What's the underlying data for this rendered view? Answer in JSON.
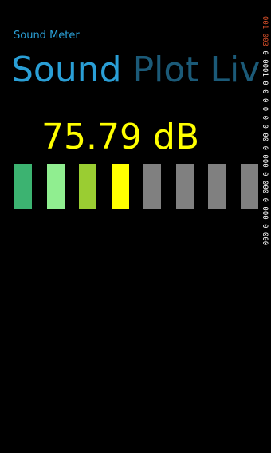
{
  "app": {
    "title": "Sound Meter"
  },
  "pivot": {
    "tabs": [
      {
        "label": "Sound",
        "active": true
      },
      {
        "label": "Plot",
        "active": false
      },
      {
        "label": "Live",
        "active": false
      }
    ]
  },
  "meter": {
    "reading": "75.79 dB",
    "reading_color": "#ffff00",
    "level_fraction": 0.5,
    "bars": [
      {
        "color": "#3cb371",
        "lit": true
      },
      {
        "color": "#90ee90",
        "lit": true
      },
      {
        "color": "#9acd32",
        "lit": true
      },
      {
        "color": "#ffff00",
        "lit": true
      },
      {
        "color": "#808080",
        "lit": false
      },
      {
        "color": "#808080",
        "lit": false
      },
      {
        "color": "#808080",
        "lit": false
      },
      {
        "color": "#808080",
        "lit": false
      }
    ]
  },
  "debug_overlay": {
    "text_top": "001 003",
    "text_rest": "0 0001 0 0 0 0 0 0 00 0 000 0 000 0 000 0 000 0 000 0",
    "accent_color": "#d9502a"
  }
}
